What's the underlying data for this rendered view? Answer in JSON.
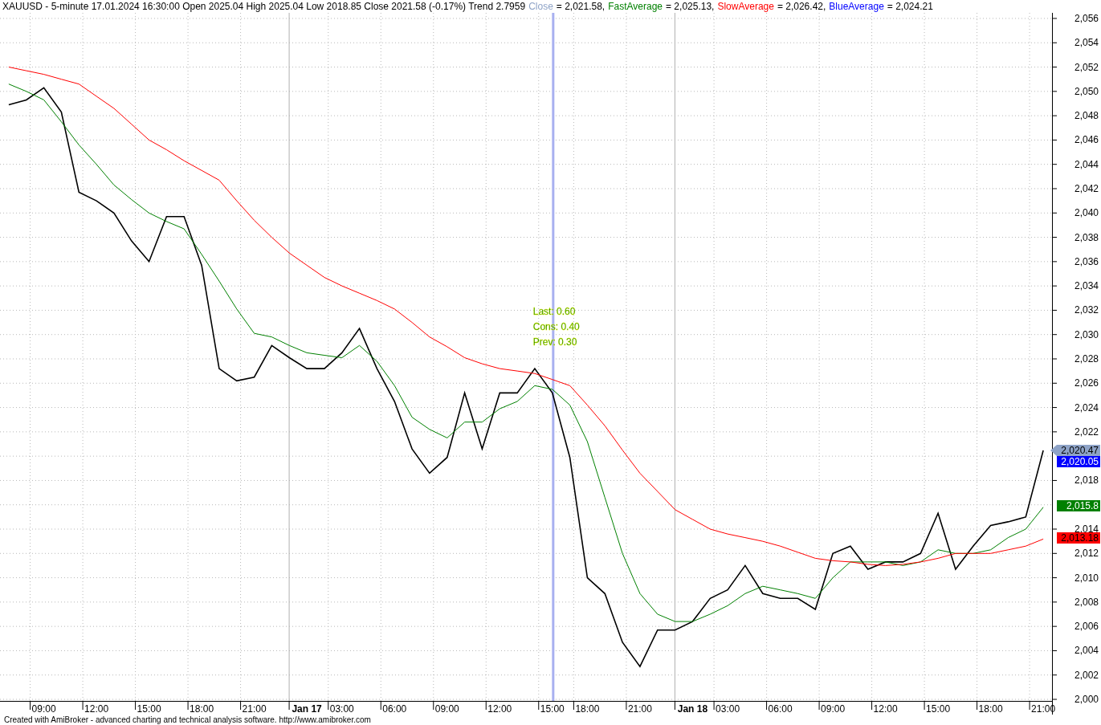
{
  "header": {
    "title": "XAUUSD - 5-minute 17.01.2024 16:30:00 Open 2025.04 High 2025.04 Low 2018.85 Close 2021.58 (-0.17%) Trend 2.7959",
    "legend": [
      {
        "name": "Close",
        "value": "= 2,021.58,",
        "color": "#8ea3c7"
      },
      {
        "name": "FastAverage",
        "value": "= 2,025.13,",
        "color": "#008000"
      },
      {
        "name": "SlowAverage",
        "value": "= 2,026.42,",
        "color": "#ff0000"
      },
      {
        "name": "BlueAverage",
        "value": "= 2,024.21",
        "color": "#0000ff"
      }
    ]
  },
  "chart": {
    "chart_data": {
      "type": "line",
      "categories": [
        null,
        null,
        "09:00",
        null,
        null,
        "12:00",
        null,
        null,
        "15:00",
        null,
        null,
        "18:00",
        null,
        null,
        "21:00",
        null,
        null,
        "Jan 17",
        null,
        "03:00",
        null,
        null,
        "06:00",
        null,
        null,
        "09:00",
        null,
        null,
        "12:00",
        null,
        null,
        "15:00",
        null,
        "18:00",
        null,
        null,
        "21:00",
        null,
        null,
        "Jan 18",
        null,
        "03:00",
        null,
        null,
        "06:00",
        null,
        null,
        "09:00",
        null,
        null,
        "12:00",
        null,
        null,
        "15:00",
        null,
        null,
        "18:00",
        null,
        null,
        "21:00"
      ],
      "series": [
        {
          "color": "#000000",
          "values": [
            2048.9,
            2049.3,
            2050.3,
            2048.3,
            2041.7,
            2041,
            2040,
            2037.7,
            2036,
            2039.7,
            2039.7,
            2035.7,
            2027.2,
            2026.2,
            2026.5,
            2029.1,
            2028.1,
            2027.2,
            2027.2,
            2028.5,
            2030.5,
            2027.2,
            2024.5,
            2020.6,
            2018.6,
            2019.9,
            2025.2,
            2020.6,
            2025.2,
            2025.2,
            2027.2,
            2025.2,
            2019.9,
            2010,
            2008.7,
            2004.7,
            2002.7,
            2005.7,
            2005.7,
            2006.4,
            2008.3,
            2009,
            2011,
            2008.7,
            2008.3,
            2008.3,
            2007.4,
            2012,
            2012.6,
            2010.7,
            2011.3,
            2011.3,
            2012,
            2015.3,
            2010.7,
            2012.6,
            2014.3,
            2014.6,
            2015,
            2020.47
          ]
        },
        {
          "color": "#008000",
          "values": [
            2050.6,
            2050,
            2049.3,
            2047.5,
            2045.6,
            2044,
            2042.3,
            2041.1,
            2040,
            2039.3,
            2038.7,
            2036.6,
            2034.4,
            2032.1,
            2030.1,
            2029.8,
            2029.1,
            2028.5,
            2028.3,
            2028.1,
            2029.1,
            2027.8,
            2025.8,
            2023.2,
            2022.2,
            2021.5,
            2022.8,
            2022.8,
            2023.9,
            2024.5,
            2025.8,
            2025.5,
            2024.2,
            2021.2,
            2016.6,
            2012,
            2008.7,
            2007,
            2006.4,
            2006.4,
            2007,
            2007.7,
            2008.7,
            2009.3,
            2009,
            2008.7,
            2008.3,
            2010,
            2011.3,
            2011.3,
            2011.3,
            2011,
            2011.3,
            2012.3,
            2012,
            2012,
            2012.3,
            2013.3,
            2014,
            2015.8
          ]
        },
        {
          "color": "#ff0000",
          "values": [
            2052,
            2051.7,
            2051.4,
            2051,
            2050.6,
            2049.6,
            2048.6,
            2047.3,
            2046,
            2045.2,
            2044.3,
            2043.5,
            2042.7,
            2041,
            2039.4,
            2038,
            2036.7,
            2035.7,
            2034.7,
            2034,
            2033.4,
            2032.8,
            2032.1,
            2031,
            2029.8,
            2029,
            2028.1,
            2027.6,
            2027.2,
            2027,
            2026.8,
            2026.3,
            2025.8,
            2024.2,
            2022.5,
            2020.5,
            2018.6,
            2017.1,
            2015.6,
            2014.8,
            2014,
            2013.6,
            2013.3,
            2013,
            2012.6,
            2012.1,
            2011.6,
            2011.4,
            2011.3,
            2011.1,
            2011,
            2011.1,
            2011.3,
            2011.6,
            2012,
            2012,
            2012,
            2012.3,
            2012.6,
            2013.18
          ]
        }
      ],
      "ylim": [
        1999.87,
        2056.46
      ],
      "grid": true,
      "yticks": [
        {
          "value": 2000,
          "label": "2,000"
        },
        {
          "value": 2002,
          "label": "2,002"
        },
        {
          "value": 2004,
          "label": "2,004"
        },
        {
          "value": 2006,
          "label": "2,006"
        },
        {
          "value": 2008,
          "label": "2,008"
        },
        {
          "value": 2010,
          "label": "2,010"
        },
        {
          "value": 2012,
          "label": "2,012"
        },
        {
          "value": 2014,
          "label": "2,014"
        },
        {
          "value": 2018,
          "label": "2,018"
        },
        {
          "value": 2022,
          "label": "2,022"
        },
        {
          "value": 2024,
          "label": "2,024"
        },
        {
          "value": 2026,
          "label": "2,026"
        },
        {
          "value": 2028,
          "label": "2,028"
        },
        {
          "value": 2030,
          "label": "2,030"
        },
        {
          "value": 2032,
          "label": "2,032"
        },
        {
          "value": 2034,
          "label": "2,034"
        },
        {
          "value": 2036,
          "label": "2,036"
        },
        {
          "value": 2038,
          "label": "2,038"
        },
        {
          "value": 2040,
          "label": "2,040"
        },
        {
          "value": 2042,
          "label": "2,042"
        },
        {
          "value": 2044,
          "label": "2,044"
        },
        {
          "value": 2046,
          "label": "2,046"
        },
        {
          "value": 2048,
          "label": "2,048"
        },
        {
          "value": 2050,
          "label": "2,050"
        },
        {
          "value": 2052,
          "label": "2,052"
        },
        {
          "value": 2054,
          "label": "2,054"
        },
        {
          "value": 2056,
          "label": "2,056"
        }
      ],
      "annotations": [
        "Last: 0.60",
        "Cons: 0.40",
        "Prev: 0.30"
      ]
    },
    "price_tags": [
      {
        "label": "2,020.47",
        "color": "#8ea3c7"
      },
      {
        "label": "2,020.05",
        "color": "#0000ff"
      },
      {
        "label": "2,015.8",
        "color": "#008000"
      },
      {
        "label": "2,013.18",
        "color": "#ff0000"
      }
    ]
  },
  "footer": "Created with AmiBroker - advanced charting and technical analysis software. http://www.amibroker.com"
}
